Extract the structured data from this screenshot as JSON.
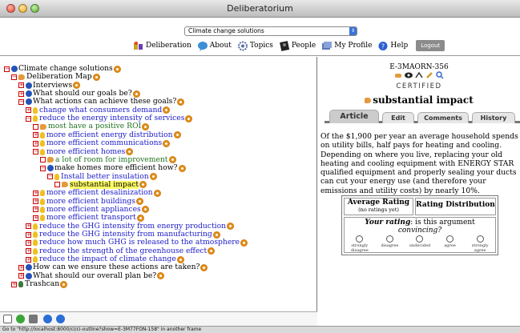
{
  "window": {
    "title": "Deliberatorium"
  },
  "toolbar": {
    "topic_select_value": "Climate change solutions",
    "nav": [
      {
        "label": "Deliberation",
        "icon": "deliberation-icon"
      },
      {
        "label": "About",
        "icon": "about-icon"
      },
      {
        "label": "Topics",
        "icon": "topics-icon"
      },
      {
        "label": "People",
        "icon": "people-icon"
      },
      {
        "label": "My Profile",
        "icon": "profile-icon"
      },
      {
        "label": "Help",
        "icon": "help-icon"
      }
    ],
    "logout_label": "Logout"
  },
  "tree": [
    {
      "text": "Climate change solutions",
      "level": 0,
      "toggle": "⊟",
      "icon": "globe",
      "color": "black",
      "gear": true
    },
    {
      "text": "Deliberation Map",
      "level": 1,
      "toggle": "⊟",
      "icon": "hand",
      "color": "black",
      "gear": true
    },
    {
      "text": "Interviews",
      "level": 2,
      "toggle": "⊞",
      "icon": "question",
      "color": "black",
      "gear": true
    },
    {
      "text": "What should our goals be?",
      "level": 2,
      "toggle": "⊞",
      "icon": "question",
      "color": "black",
      "gear": true
    },
    {
      "text": "What actions can achieve these goals?",
      "level": 2,
      "toggle": "⊟",
      "icon": "question",
      "color": "black",
      "gear": true
    },
    {
      "text": "change what consumers demand",
      "level": 3,
      "toggle": "⊞",
      "icon": "bulb",
      "color": "blue",
      "gear": true
    },
    {
      "text": "reduce the energy intensity of services",
      "level": 3,
      "toggle": "⊟",
      "icon": "bulb",
      "color": "blue",
      "gear": true
    },
    {
      "text": "most have a positive ROI",
      "level": 4,
      "toggle": "□",
      "icon": "hand",
      "color": "green",
      "gear": true
    },
    {
      "text": "more efficient energy distribution",
      "level": 4,
      "toggle": "⊞",
      "icon": "bulb",
      "color": "blue",
      "gear": true
    },
    {
      "text": "more efficient communications",
      "level": 4,
      "toggle": "⊞",
      "icon": "bulb",
      "color": "blue",
      "gear": true
    },
    {
      "text": "more efficient homes",
      "level": 4,
      "toggle": "⊟",
      "icon": "bulb",
      "color": "blue",
      "gear": true
    },
    {
      "text": "a lot of room for improvement",
      "level": 5,
      "toggle": "□",
      "icon": "hand",
      "color": "green",
      "gear": true
    },
    {
      "text": "make homes more efficient how?",
      "level": 5,
      "toggle": "⊟",
      "icon": "question",
      "color": "black",
      "gear": true
    },
    {
      "text": "Install better insulation",
      "level": 6,
      "toggle": "⊟",
      "icon": "bulb",
      "color": "blue",
      "gear": true
    },
    {
      "text": "substantial impact",
      "level": 7,
      "toggle": "□",
      "icon": "hand",
      "color": "black",
      "gear": true,
      "highlight": true
    },
    {
      "text": "more efficient desalinization",
      "level": 4,
      "toggle": "⊞",
      "icon": "bulb",
      "color": "blue",
      "gear": true
    },
    {
      "text": "more efficient buildings",
      "level": 4,
      "toggle": "⊞",
      "icon": "bulb",
      "color": "blue",
      "gear": true
    },
    {
      "text": "more efficient appliances",
      "level": 4,
      "toggle": "⊞",
      "icon": "bulb",
      "color": "blue",
      "gear": true
    },
    {
      "text": "more efficient transport",
      "level": 4,
      "toggle": "⊞",
      "icon": "bulb",
      "color": "blue",
      "gear": true
    },
    {
      "text": "reduce the GHG intensity from energy production",
      "level": 3,
      "toggle": "⊞",
      "icon": "bulb",
      "color": "blue",
      "gear": true
    },
    {
      "text": "reduce the GHG intensity from manufacturing",
      "level": 3,
      "toggle": "⊞",
      "icon": "bulb",
      "color": "blue",
      "gear": true
    },
    {
      "text": "reduce how much GHG is released to the atmosphere",
      "level": 3,
      "toggle": "⊞",
      "icon": "bulb",
      "color": "blue",
      "gear": true
    },
    {
      "text": "reduce the strength of the greenhouse effect",
      "level": 3,
      "toggle": "⊞",
      "icon": "bulb",
      "color": "blue",
      "gear": true
    },
    {
      "text": "reduce the impact of climate change",
      "level": 3,
      "toggle": "⊞",
      "icon": "bulb",
      "color": "blue",
      "gear": true
    },
    {
      "text": "How can we ensure these actions are taken?",
      "level": 2,
      "toggle": "⊞",
      "icon": "question",
      "color": "black",
      "gear": true
    },
    {
      "text": "What should our overall plan be?",
      "level": 2,
      "toggle": "⊞",
      "icon": "question",
      "color": "black",
      "gear": true
    },
    {
      "text": "Trashcan",
      "level": 1,
      "toggle": "⊞",
      "icon": "trash",
      "color": "black",
      "gear": true
    }
  ],
  "status_bar": "Go to \"http://localhost:8000/ci/ci-outline?show=E-3M77FON-158\" in another frame",
  "detail": {
    "id": "E-3MAORN-356",
    "certified": "CERTIFIED",
    "title": "substantial impact",
    "tabs": [
      "Article",
      "Edit",
      "Comments",
      "History"
    ],
    "body": "Of the $1,900 per year an average household spends on utility bills, half pays for heating and cooling. Depending on where you live, replacing your old heating and cooling equipment with ENERGY STAR qualified equipment and properly sealing your ducts can cut your energy use (and therefore your emissions and utility costs) by nearly 10%.",
    "rating": {
      "avg_label": "Average Rating",
      "avg_sub": "(no ratings yet)",
      "dist_label": "Rating Distribution",
      "your_rating_bold": "Your rating",
      "your_rating_mid": ": is this argument ",
      "your_rating_italic": "convincing?",
      "options": [
        "strongly disagree",
        "disagree",
        "undecided",
        "agree",
        "strongly agree"
      ]
    }
  },
  "colors": {
    "blue_link": "#1a1ac8",
    "green_pro": "#207020",
    "highlight": "#ffff66",
    "toggle_red": "#cc0000"
  }
}
